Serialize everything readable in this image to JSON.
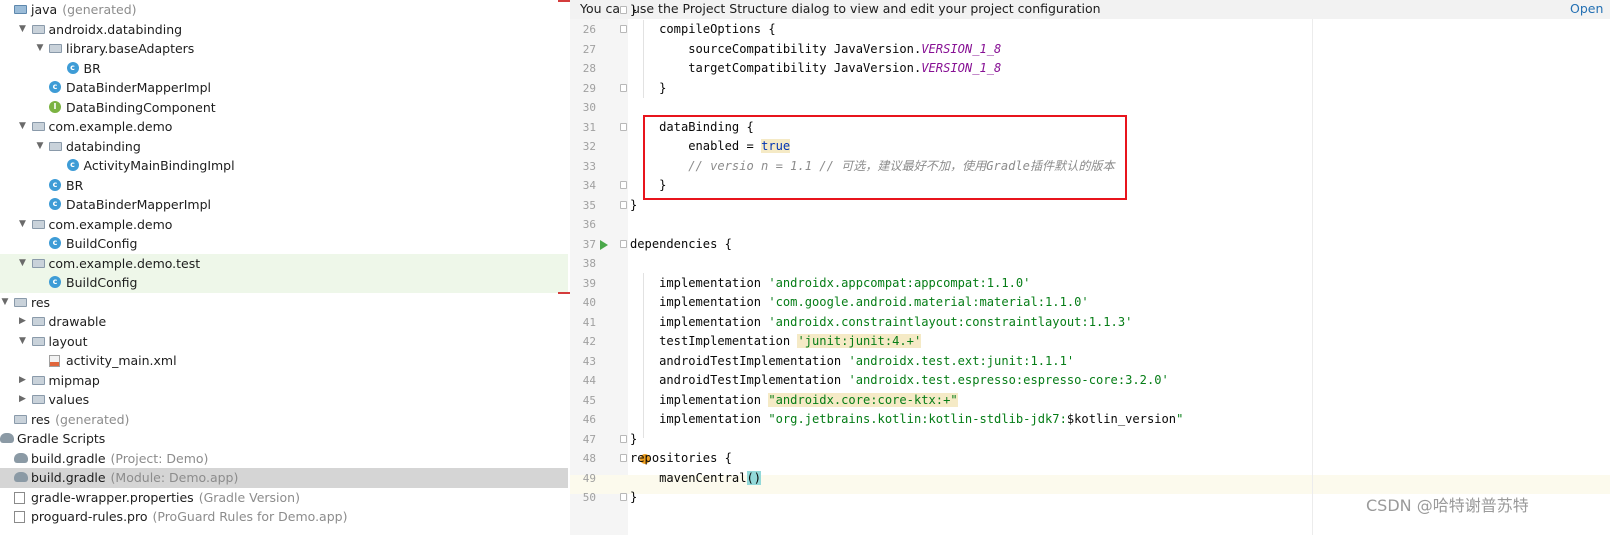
{
  "banner": {
    "text": "You can use the Project Structure dialog to view and edit your project configuration",
    "link": "Open"
  },
  "tree": [
    {
      "indent": 0,
      "arrow": "",
      "icon": "folder-src-icon",
      "label": "java",
      "suffix": "(generated)",
      "muted": true
    },
    {
      "indent": 1,
      "arrow": "▼",
      "icon": "folder-icon",
      "label": "androidx.databinding",
      "suffix": ""
    },
    {
      "indent": 2,
      "arrow": "▼",
      "icon": "folder-icon",
      "label": "library.baseAdapters",
      "suffix": ""
    },
    {
      "indent": 3,
      "arrow": "",
      "icon": "class-icon",
      "label": "BR",
      "suffix": ""
    },
    {
      "indent": 2,
      "arrow": "",
      "icon": "class-icon",
      "label": "DataBinderMapperImpl",
      "suffix": ""
    },
    {
      "indent": 2,
      "arrow": "",
      "icon": "interface-icon",
      "label": "DataBindingComponent",
      "suffix": ""
    },
    {
      "indent": 1,
      "arrow": "▼",
      "icon": "folder-icon",
      "label": "com.example.demo",
      "suffix": "",
      "squig": true
    },
    {
      "indent": 2,
      "arrow": "▼",
      "icon": "folder-icon",
      "label": "databinding",
      "suffix": ""
    },
    {
      "indent": 3,
      "arrow": "",
      "icon": "class-icon",
      "label": "ActivityMainBindingImpl",
      "suffix": ""
    },
    {
      "indent": 2,
      "arrow": "",
      "icon": "class-icon",
      "label": "BR",
      "suffix": ""
    },
    {
      "indent": 2,
      "arrow": "",
      "icon": "class-icon",
      "label": "DataBinderMapperImpl",
      "suffix": "",
      "squig": true
    },
    {
      "indent": 1,
      "arrow": "▼",
      "icon": "folder-icon",
      "label": "com.example.demo",
      "suffix": ""
    },
    {
      "indent": 2,
      "arrow": "",
      "icon": "class-icon",
      "label": "BuildConfig",
      "suffix": ""
    },
    {
      "indent": 1,
      "arrow": "▼",
      "icon": "folder-icon",
      "label": "com.example.demo.test",
      "suffix": "",
      "hl": true
    },
    {
      "indent": 2,
      "arrow": "",
      "icon": "class-icon",
      "label": "BuildConfig",
      "suffix": "",
      "hl": true
    },
    {
      "indent": 0,
      "arrow": "▼",
      "icon": "folder-icon",
      "label": "res",
      "suffix": ""
    },
    {
      "indent": 1,
      "arrow": "▶",
      "icon": "folder-icon",
      "label": "drawable",
      "suffix": ""
    },
    {
      "indent": 1,
      "arrow": "▼",
      "icon": "folder-icon",
      "label": "layout",
      "suffix": ""
    },
    {
      "indent": 2,
      "arrow": "",
      "icon": "xml-file-icon",
      "label": "activity_main.xml",
      "suffix": ""
    },
    {
      "indent": 1,
      "arrow": "▶",
      "icon": "folder-icon",
      "label": "mipmap",
      "suffix": ""
    },
    {
      "indent": 1,
      "arrow": "▶",
      "icon": "folder-icon",
      "label": "values",
      "suffix": ""
    },
    {
      "indent": 0,
      "arrow": "",
      "icon": "folder-icon",
      "label": "res",
      "suffix": "(generated)",
      "muted": true
    },
    {
      "indent": -1,
      "arrow": "",
      "icon": "gradle-icon",
      "label": "Gradle Scripts",
      "suffix": ""
    },
    {
      "indent": 0,
      "arrow": "",
      "icon": "gradle-icon",
      "label": "build.gradle",
      "suffix": "(Project: Demo)"
    },
    {
      "indent": 0,
      "arrow": "",
      "icon": "gradle-icon",
      "label": "build.gradle",
      "suffix": "(Module: Demo.app)",
      "sel": true
    },
    {
      "indent": 0,
      "arrow": "",
      "icon": "properties-file-icon",
      "label": "gradle-wrapper.properties",
      "suffix": "(Gradle Version)"
    },
    {
      "indent": 0,
      "arrow": "",
      "icon": "text-file-icon",
      "label": "proguard-rules.pro",
      "suffix": "(ProGuard Rules for Demo.app)"
    }
  ],
  "code_lines": [
    {
      "num": "",
      "segs": [
        {
          "t": "}"
        }
      ]
    },
    {
      "num": "26",
      "segs": [
        {
          "t": "    compileOptions {"
        }
      ]
    },
    {
      "num": "27",
      "segs": [
        {
          "t": "        sourceCompatibility JavaVersion."
        },
        {
          "t": "VERSION_1_8",
          "c": "const"
        }
      ]
    },
    {
      "num": "28",
      "segs": [
        {
          "t": "        targetCompatibility JavaVersion."
        },
        {
          "t": "VERSION_1_8",
          "c": "const"
        }
      ]
    },
    {
      "num": "29",
      "segs": [
        {
          "t": "    }"
        }
      ]
    },
    {
      "num": "30",
      "segs": []
    },
    {
      "num": "31",
      "segs": [
        {
          "t": "    dataBinding {"
        }
      ]
    },
    {
      "num": "32",
      "segs": [
        {
          "t": "        enabled = "
        },
        {
          "t": "true",
          "c": "kw hlbg"
        }
      ]
    },
    {
      "num": "33",
      "segs": [
        {
          "t": "        // versio n = 1.1 // 可选，建议最好不加，使用Gradle插件默认的版本",
          "c": "cmt"
        }
      ]
    },
    {
      "num": "34",
      "segs": [
        {
          "t": "    }"
        }
      ]
    },
    {
      "num": "35",
      "segs": [
        {
          "t": "}"
        }
      ]
    },
    {
      "num": "36",
      "segs": []
    },
    {
      "num": "37",
      "segs": [
        {
          "t": "dependencies {"
        }
      ]
    },
    {
      "num": "38",
      "segs": []
    },
    {
      "num": "39",
      "segs": [
        {
          "t": "    implementation "
        },
        {
          "t": "'androidx.appcompat:appcompat:1.1.0'",
          "c": "str"
        }
      ]
    },
    {
      "num": "40",
      "segs": [
        {
          "t": "    implementation "
        },
        {
          "t": "'com.google.android.material:material:1.1.0'",
          "c": "str"
        }
      ]
    },
    {
      "num": "41",
      "segs": [
        {
          "t": "    implementation "
        },
        {
          "t": "'androidx.constraintlayout:constraintlayout:1.1.3'",
          "c": "str"
        }
      ]
    },
    {
      "num": "42",
      "segs": [
        {
          "t": "    testImplementation "
        },
        {
          "t": "'junit:junit:4.+'",
          "c": "str hlbg"
        }
      ]
    },
    {
      "num": "43",
      "segs": [
        {
          "t": "    androidTestImplementation "
        },
        {
          "t": "'androidx.test.ext:junit:1.1.1'",
          "c": "str"
        }
      ]
    },
    {
      "num": "44",
      "segs": [
        {
          "t": "    androidTestImplementation "
        },
        {
          "t": "'androidx.test.espresso:espresso-core:3.2.0'",
          "c": "str"
        }
      ]
    },
    {
      "num": "45",
      "segs": [
        {
          "t": "    implementation "
        },
        {
          "t": "\"androidx.core:core-ktx:+\"",
          "c": "strdq hlbg"
        }
      ]
    },
    {
      "num": "46",
      "segs": [
        {
          "t": "    implementation "
        },
        {
          "t": "\"org.jetbrains.kotlin:kotlin-stdlib-jdk7:",
          "c": "strdq"
        },
        {
          "t": "$kotlin_version"
        },
        {
          "t": "\"",
          "c": "strdq"
        }
      ]
    },
    {
      "num": "47",
      "segs": [
        {
          "t": "}"
        }
      ]
    },
    {
      "num": "48",
      "segs": [
        {
          "t": "repositories {"
        }
      ]
    },
    {
      "num": "49",
      "segs": [
        {
          "t": "    mavenCentral"
        },
        {
          "t": "()",
          "c": "brace-hl"
        }
      ]
    },
    {
      "num": "50",
      "segs": [
        {
          "t": "}"
        }
      ]
    }
  ],
  "watermark": "CSDN @哈特谢普苏特"
}
